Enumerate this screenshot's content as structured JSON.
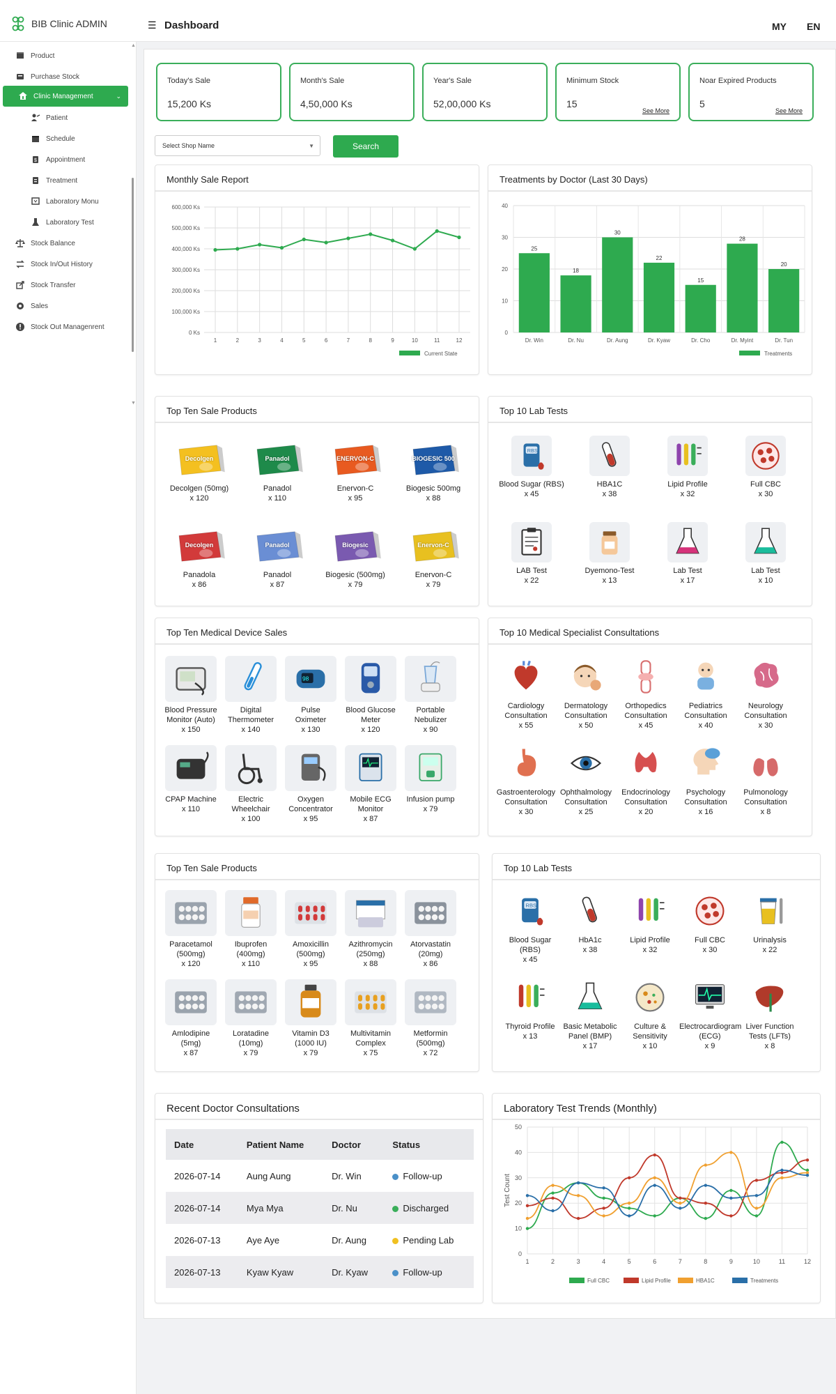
{
  "header": {
    "brand": "BIB Clinic ADMIN",
    "menu_icon": "☰",
    "title": "Dashboard",
    "lang_my": "MY",
    "lang_en": "EN"
  },
  "sidebar": {
    "items": [
      {
        "label": "Product",
        "icon": "box-icon",
        "level": 0
      },
      {
        "label": "Purchase Stock",
        "icon": "cart-icon",
        "level": 0
      },
      {
        "label": "Clinic Management",
        "icon": "clinic-icon",
        "level": 0,
        "active": true
      },
      {
        "label": "Patient",
        "icon": "patient-icon",
        "level": 1
      },
      {
        "label": "Schedule",
        "icon": "calendar-icon",
        "level": 1
      },
      {
        "label": "Appointment",
        "icon": "appointment-icon",
        "level": 1
      },
      {
        "label": "Treatment",
        "icon": "treatment-icon",
        "level": 1
      },
      {
        "label": "Laboratory Monu",
        "icon": "lab-menu-icon",
        "level": 1
      },
      {
        "label": "Laboratory Test",
        "icon": "lab-test-icon",
        "level": 1
      },
      {
        "label": "Stock Balance",
        "icon": "scale-icon",
        "level": 0
      },
      {
        "label": "Stock In/Out History",
        "icon": "swap-icon",
        "level": 0
      },
      {
        "label": "Stock Transfer",
        "icon": "transfer-icon",
        "level": 0
      },
      {
        "label": "Sales",
        "icon": "gear-icon",
        "level": 0
      },
      {
        "label": "Stock Out Managenrent",
        "icon": "info-icon",
        "level": 0
      }
    ]
  },
  "stats": [
    {
      "label": "Today's Sale",
      "value": "15,200 Ks"
    },
    {
      "label": "Month's Sale",
      "value": "4,50,000 Ks"
    },
    {
      "label": "Year's Sale",
      "value": "52,00,000 Ks"
    },
    {
      "label": "Minimum Stock",
      "value": "15",
      "more": "See More"
    },
    {
      "label": "Noar Expired Products",
      "value": "5",
      "more": "See More"
    }
  ],
  "filter": {
    "shop_placeholder": "Select Shop Name",
    "search_label": "Search"
  },
  "monthly_sale": {
    "title": "Monthly Sale Report"
  },
  "treatments": {
    "title": "Treatments by Doctor (Last 30 Days)"
  },
  "chart_data": [
    {
      "type": "line",
      "title": "Monthly Sale Report",
      "x": [
        1,
        2,
        3,
        4,
        5,
        6,
        7,
        8,
        9,
        10,
        11,
        12
      ],
      "yticks": [
        "0 Ks",
        "100,000 Ks",
        "200,000 Ks",
        "300,000 Ks",
        "400,000 Ks",
        "500,000 Ks",
        "600,000 Ks"
      ],
      "ylim": [
        0,
        600000
      ],
      "series": [
        {
          "name": "Current State",
          "values": [
            395000,
            400000,
            420000,
            405000,
            445000,
            430000,
            450000,
            470000,
            440000,
            400000,
            485000,
            455000
          ]
        }
      ],
      "color": "#2eaa4f",
      "grid": true,
      "legend": "bottom-right"
    },
    {
      "type": "bar",
      "title": "Treatments by Doctor (Last 30 Days)",
      "categories": [
        "Dr. Win",
        "Dr. Nu",
        "Dr. Aung",
        "Dr. Kyaw",
        "Dr. Cho",
        "Dr. Myint",
        "Dr. Tun"
      ],
      "values": [
        25,
        18,
        30,
        22,
        15,
        28,
        20
      ],
      "series_name": "Treatments",
      "ylim": [
        0,
        40
      ],
      "yticks": [
        0,
        10,
        20,
        30,
        40
      ],
      "color": "#2eaa4f",
      "grid": true,
      "legend": "bottom-right"
    },
    {
      "type": "line",
      "title": "Laboratory Test Trends (Monthly)",
      "x": [
        1,
        2,
        3,
        4,
        5,
        6,
        7,
        8,
        9,
        10,
        11,
        12
      ],
      "ylabel": "Test Count",
      "ylim": [
        0,
        50
      ],
      "yticks": [
        0,
        10,
        20,
        30,
        40,
        50
      ],
      "grid": true,
      "legend": "bottom",
      "series": [
        {
          "name": "Full CBC",
          "color": "#2eaa4f",
          "values": [
            10,
            24,
            28,
            22,
            18,
            15,
            22,
            14,
            25,
            15,
            44,
            33
          ]
        },
        {
          "name": "Lipid Profile",
          "color": "#c0392b",
          "values": [
            19,
            22,
            14,
            18,
            30,
            39,
            22,
            20,
            15,
            29,
            32,
            37
          ]
        },
        {
          "name": "HBA1C",
          "color": "#f0a030",
          "values": [
            14,
            27,
            23,
            15,
            20,
            30,
            20,
            35,
            40,
            18,
            30,
            32
          ]
        },
        {
          "name": "Treatments",
          "color": "#2a6fa8",
          "values": [
            23,
            17,
            28,
            26,
            15,
            27,
            18,
            27,
            22,
            23,
            33,
            31
          ]
        }
      ]
    }
  ],
  "top_products_1": {
    "title": "Top Ten Sale Products",
    "items": [
      {
        "name": "Decolgen (50mg)",
        "qty": "x 120",
        "color": "#f4c020",
        "brand": "Decolgen"
      },
      {
        "name": "Panadol",
        "qty": "x 110",
        "color": "#1e8a4a",
        "brand": "Panadol"
      },
      {
        "name": "Enervon-C",
        "qty": "x 95",
        "color": "#e85a20",
        "brand": "ENERVON-C"
      },
      {
        "name": "Biogesic 500mg",
        "qty": "x 88",
        "color": "#1e5aa8",
        "brand": "BIOGESIC 500"
      },
      {
        "name": "Panadola",
        "qty": "x 86",
        "color": "#d23a3a",
        "brand": "Decolgen"
      },
      {
        "name": "Panadol",
        "qty": "x 87",
        "color": "#6a8ed4",
        "brand": "Panadol"
      },
      {
        "name": "Biogesic (500mg)",
        "qty": "x 79",
        "color": "#7a5ab0",
        "brand": "Biogesic"
      },
      {
        "name": "Enervon-C",
        "qty": "x 79",
        "color": "#e8c020",
        "brand": "Enervon-C"
      }
    ]
  },
  "top_labs_1": {
    "title": "Top 10 Lab Tests",
    "items": [
      {
        "name": "Blood Sugar (RBS)",
        "qty": "x 45",
        "icon": "glucometer-icon",
        "color": "#2a6fa8"
      },
      {
        "name": "HBA1C",
        "qty": "x 38",
        "icon": "test-tube-icon",
        "color": "#c0392b"
      },
      {
        "name": "Lipid Profile",
        "qty": "x 32",
        "icon": "tubes-rack-icon",
        "color": "#8e44ad"
      },
      {
        "name": "Full CBC",
        "qty": "x 30",
        "icon": "blood-cells-icon",
        "color": "#c0392b"
      },
      {
        "name": "LAB Test",
        "qty": "x 22",
        "icon": "clipboard-icon",
        "color": "#555555"
      },
      {
        "name": "Dyemono-Test",
        "qty": "x 13",
        "icon": "jar-icon",
        "color": "#e67e22"
      },
      {
        "name": "Lab Test",
        "qty": "x 17",
        "icon": "flask-icon",
        "color": "#d6337a"
      },
      {
        "name": "Lab Test",
        "qty": "x 10",
        "icon": "flask-icon",
        "color": "#1abc9c"
      }
    ]
  },
  "devices": {
    "title": "Top Ten Medical Device Sales",
    "items": [
      {
        "name1": "Blood Pressure",
        "name2": "Monitor (Auto)",
        "qty": "x 150",
        "icon": "bp-monitor-icon",
        "color": "#555555"
      },
      {
        "name1": "Digital",
        "name2": "Thermometer",
        "qty": "x 140",
        "icon": "thermometer-icon",
        "color": "#2a8fd8"
      },
      {
        "name1": "Pulse",
        "name2": "Oximeter",
        "qty": "x 130",
        "icon": "oximeter-icon",
        "color": "#2a6fa8"
      },
      {
        "name1": "Blood Glucose",
        "name2": "Meter",
        "qty": "x 120",
        "icon": "glucose-meter-icon",
        "color": "#2a5aa8"
      },
      {
        "name1": "Portable",
        "name2": "Nebulizer",
        "qty": "x 90",
        "icon": "nebulizer-icon",
        "color": "#7aa8d8"
      },
      {
        "name1": "CPAP Machine",
        "name2": "",
        "qty": "x 110",
        "icon": "cpap-icon",
        "color": "#333333"
      },
      {
        "name1": "Electric",
        "name2": "Wheelchair",
        "qty": "x 100",
        "icon": "wheelchair-icon",
        "color": "#333333"
      },
      {
        "name1": "Oxygen",
        "name2": "Concentrator",
        "qty": "x 95",
        "icon": "oxygen-icon",
        "color": "#444444"
      },
      {
        "name1": "Mobile ECG",
        "name2": "Monitor",
        "qty": "x 87",
        "icon": "ecg-monitor-icon",
        "color": "#2a6fa8"
      },
      {
        "name1": "Infusion pump",
        "name2": "",
        "qty": "x 79",
        "icon": "infusion-pump-icon",
        "color": "#3aa86a"
      }
    ]
  },
  "specialists": {
    "title": "Top 10 Medical Specialist Consultations",
    "items": [
      {
        "name1": "Cardiology",
        "name2": "Consultation",
        "qty": "x 55",
        "icon": "heart-icon",
        "color": "#c0392b"
      },
      {
        "name1": "Dermatology",
        "name2": "Consultation",
        "qty": "x 50",
        "icon": "face-icon",
        "color": "#e8a878"
      },
      {
        "name1": "Orthopedics",
        "name2": "Consultation",
        "qty": "x 45",
        "icon": "bone-joint-icon",
        "color": "#d87070"
      },
      {
        "name1": "Pediatrics",
        "name2": "Consultation",
        "qty": "x 40",
        "icon": "baby-icon",
        "color": "#e8b070"
      },
      {
        "name1": "Neurology",
        "name2": "Consultation",
        "qty": "x 30",
        "icon": "brain-icon",
        "color": "#d66a8a"
      },
      {
        "name1": "Gastroenterology",
        "name2": "Consultation",
        "qty": "x 30",
        "icon": "stomach-icon",
        "color": "#e07050"
      },
      {
        "name1": "Ophthalmology",
        "name2": "Consultation",
        "qty": "x 25",
        "icon": "eye-icon",
        "color": "#2a6fa8"
      },
      {
        "name1": "Endocrinology",
        "name2": "Consultation",
        "qty": "x 20",
        "icon": "thyroid-icon",
        "color": "#d65050"
      },
      {
        "name1": "Psychology",
        "name2": "Consultation",
        "qty": "x 16",
        "icon": "mind-icon",
        "color": "#5aa0d8"
      },
      {
        "name1": "Pulmonology",
        "name2": "Consultation",
        "qty": "x 8",
        "icon": "lungs-icon",
        "color": "#d66a6a"
      }
    ]
  },
  "top_products_2": {
    "title": "Top Ten Sale Products",
    "items": [
      {
        "name1": "Paracetamol",
        "name2": "(500mg)",
        "qty": "x 120",
        "icon": "blister-icon",
        "color": "#9aa3ad"
      },
      {
        "name1": "Ibuprofen",
        "name2": "(400mg)",
        "qty": "x 110",
        "icon": "pill-bottle-icon",
        "color": "#e06a2a"
      },
      {
        "name1": "Amoxicillin",
        "name2": "(500mg)",
        "qty": "x 95",
        "icon": "capsule-pack-icon",
        "color": "#d23a3a"
      },
      {
        "name1": "Azithromycin",
        "name2": "(250mg)",
        "qty": "x 88",
        "icon": "box-pack-icon",
        "color": "#2a6fa8"
      },
      {
        "name1": "Atorvastatin",
        "name2": "(20mg)",
        "qty": "x 86",
        "icon": "blister-icon",
        "color": "#8a929c"
      },
      {
        "name1": "Amlodipine",
        "name2": "(5mg)",
        "qty": "x 87",
        "icon": "blister-icon",
        "color": "#9aa3ad"
      },
      {
        "name1": "Loratadine",
        "name2": "(10mg)",
        "qty": "x 79",
        "icon": "blister-icon",
        "color": "#a0a8b2"
      },
      {
        "name1": "Vitamin D3",
        "name2": "(1000 IU)",
        "qty": "x 79",
        "icon": "vitamin-bottle-icon",
        "color": "#d88a1a"
      },
      {
        "name1": "Multivitamin",
        "name2": "Complex",
        "qty": "x 75",
        "icon": "capsule-pack-icon",
        "color": "#e8a020"
      },
      {
        "name1": "Metformin",
        "name2": "(500mg)",
        "qty": "x 72",
        "icon": "blister-icon",
        "color": "#b0b8c2"
      }
    ]
  },
  "top_labs_2": {
    "title": "Top 10 Lab Tests",
    "items": [
      {
        "name1": "Blood Sugar (RBS)",
        "name2": "",
        "qty": "x 45",
        "icon": "glucometer-icon",
        "color": "#2a6fa8"
      },
      {
        "name1": "HbA1c",
        "name2": "",
        "qty": "x 38",
        "icon": "test-tube-icon",
        "color": "#c0392b"
      },
      {
        "name1": "Lipid Profile",
        "name2": "",
        "qty": "x 32",
        "icon": "tubes-rack-icon",
        "color": "#8e44ad"
      },
      {
        "name1": "Full CBC",
        "name2": "",
        "qty": "x 30",
        "icon": "blood-cells-icon",
        "color": "#c0392b"
      },
      {
        "name1": "Urinalysis",
        "name2": "",
        "qty": "x 22",
        "icon": "urine-cup-icon",
        "color": "#e8c020"
      },
      {
        "name1": "Thyroid Profile",
        "name2": "",
        "qty": "x 13",
        "icon": "tubes-rack-icon",
        "color": "#c0392b"
      },
      {
        "name1": "Basic Metabolic",
        "name2": "Panel (BMP)",
        "qty": "x 17",
        "icon": "flask-icon",
        "color": "#1abc9c"
      },
      {
        "name1": "Culture &",
        "name2": "Sensitivity",
        "qty": "x 10",
        "icon": "petri-dish-icon",
        "color": "#d88a1a"
      },
      {
        "name1": "Electrocardiogram",
        "name2": "(ECG)",
        "qty": "x 9",
        "icon": "ecg-screen-icon",
        "color": "#2a6fa8"
      },
      {
        "name1": "Liver Function",
        "name2": "Tests (LFTs)",
        "qty": "x 8",
        "icon": "liver-icon",
        "color": "#b03a2a"
      }
    ]
  },
  "consultations": {
    "title": "Recent Doctor Consultations",
    "headers": [
      "Date",
      "Patient Name",
      "Doctor",
      "Status"
    ],
    "rows": [
      {
        "date": "2026-07-14",
        "patient": "Aung Aung",
        "doctor": "Dr. Win",
        "status": "Follow-up",
        "status_color": "#4a90c8"
      },
      {
        "date": "2026-07-14",
        "patient": "Mya Mya",
        "doctor": "Dr. Nu",
        "status": "Discharged",
        "status_color": "#3aae5a"
      },
      {
        "date": "2026-07-13",
        "patient": "Aye Aye",
        "doctor": "Dr. Aung",
        "status": "Pending Lab",
        "status_color": "#f0c020"
      },
      {
        "date": "2026-07-13",
        "patient": "Kyaw Kyaw",
        "doctor": "Dr. Kyaw",
        "status": "Follow-up",
        "status_color": "#4a90c8"
      }
    ]
  },
  "lab_trends": {
    "title": "Laboratory Test Trends (Monthly)"
  }
}
